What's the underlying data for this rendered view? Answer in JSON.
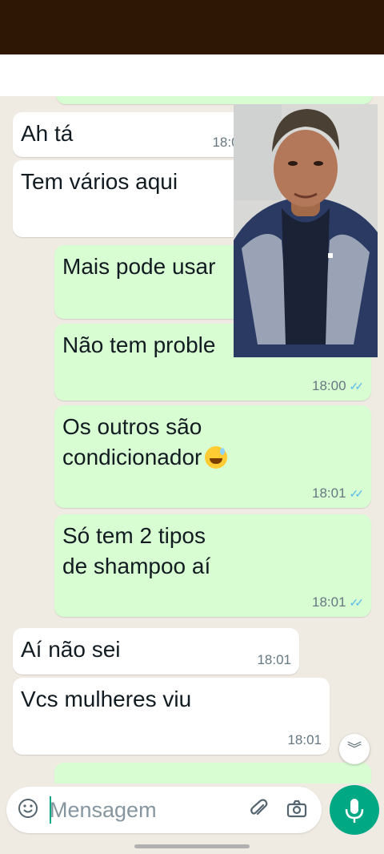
{
  "messages": [
    {
      "text": "Ah tá",
      "time": "18:00",
      "dir": "in"
    },
    {
      "text": "Tem vários aqui",
      "time": "",
      "dir": "in"
    },
    {
      "text": "Mais pode usar",
      "time": "",
      "dir": "out"
    },
    {
      "text": "Não tem proble",
      "time": "18:00",
      "dir": "out"
    },
    {
      "text": "Os outros são\ncondicionador",
      "time": "18:01",
      "dir": "out",
      "emoji": "grinning-sweat-emoji"
    },
    {
      "text": "Só tem 2 tipos\nde shampoo aí",
      "time": "18:01",
      "dir": "out"
    },
    {
      "text": "Aí não sei",
      "time": "18:01",
      "dir": "in"
    },
    {
      "text": "Vcs mulheres viu",
      "time": "18:01",
      "dir": "in"
    }
  ],
  "composer": {
    "placeholder": "Mensagem",
    "emoji_icon": "emoji-icon",
    "attach_icon": "paperclip-icon",
    "camera_icon": "camera-icon"
  },
  "mic_icon": "microphone-icon",
  "scroll_icon": "double-chevron-down-icon",
  "colors": {
    "status_bar": "#2e1705",
    "chat_bg": "#efeae2",
    "outgoing_bubble": "#d9fdd3",
    "incoming_bubble": "#ffffff",
    "accent": "#00a884",
    "read_ticks": "#53bdeb"
  }
}
